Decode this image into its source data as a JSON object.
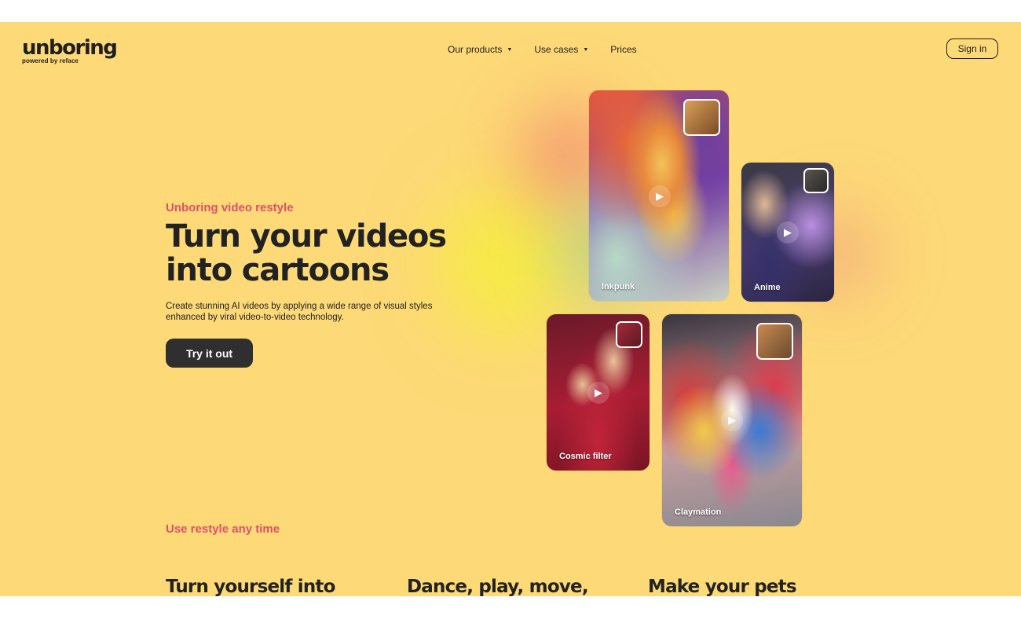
{
  "header": {
    "logo_word": "unboring",
    "logo_sub": "powered by reface",
    "nav": [
      {
        "label": "Our products",
        "has_caret": true
      },
      {
        "label": "Use cases",
        "has_caret": true
      },
      {
        "label": "Prices",
        "has_caret": false
      }
    ],
    "caret_glyph": "▼",
    "signin_label": "Sign in"
  },
  "hero": {
    "eyebrow": "Unboring video restyle",
    "headline_line1": "Turn your videos",
    "headline_line2": "into cartoons",
    "description_line1": "Create stunning AI videos by applying a wide range of visual styles",
    "description_line2": "enhanced by viral video-to-video technology.",
    "cta_label": "Try it out"
  },
  "cards": [
    {
      "label": "Inkpunk"
    },
    {
      "label": "Anime"
    },
    {
      "label": "Cosmic filter"
    },
    {
      "label": "Claymation"
    }
  ],
  "play_glyph": "▶",
  "section2": {
    "eyebrow": "Use restyle any time",
    "headings": [
      "Turn yourself into",
      "Dance, play, move,",
      "Make your pets"
    ]
  },
  "colors": {
    "background": "#fdd977",
    "accent": "#e0506a",
    "text": "#222222",
    "button": "#2f2f2f"
  }
}
